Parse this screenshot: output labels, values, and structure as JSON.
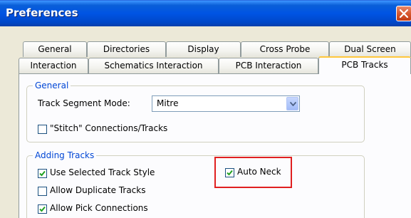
{
  "window": {
    "title": "Preferences"
  },
  "tabs": {
    "row1": [
      "General",
      "Directories",
      "Display",
      "Cross Probe",
      "Dual Screen"
    ],
    "row2": [
      "Interaction",
      "Schematics Interaction",
      "PCB Interaction",
      "PCB Tracks"
    ],
    "active": "PCB Tracks"
  },
  "general_group": {
    "title": "General",
    "track_segment_mode_label": "Track Segment Mode:",
    "track_segment_mode_value": "Mitre",
    "stitch_label": "\"Stitch\" Connections/Tracks",
    "stitch_checked": false
  },
  "adding_tracks_group": {
    "title": "Adding Tracks",
    "use_selected_track_style_label": "Use Selected Track Style",
    "use_selected_track_style_checked": true,
    "allow_duplicate_tracks_label": "Allow Duplicate Tracks",
    "allow_duplicate_tracks_checked": false,
    "allow_pick_connections_label": "Allow Pick Connections",
    "allow_pick_connections_checked": true,
    "auto_neck_label": "Auto Neck",
    "auto_neck_checked": true
  },
  "colors": {
    "titlebar": "#0054E3",
    "group_title": "#0046D5",
    "highlight": "#E02020",
    "active_tab_accent": "#FFC73C"
  },
  "icons": [
    "close-icon",
    "dropdown-arrow-icon",
    "checkmark-icon"
  ]
}
